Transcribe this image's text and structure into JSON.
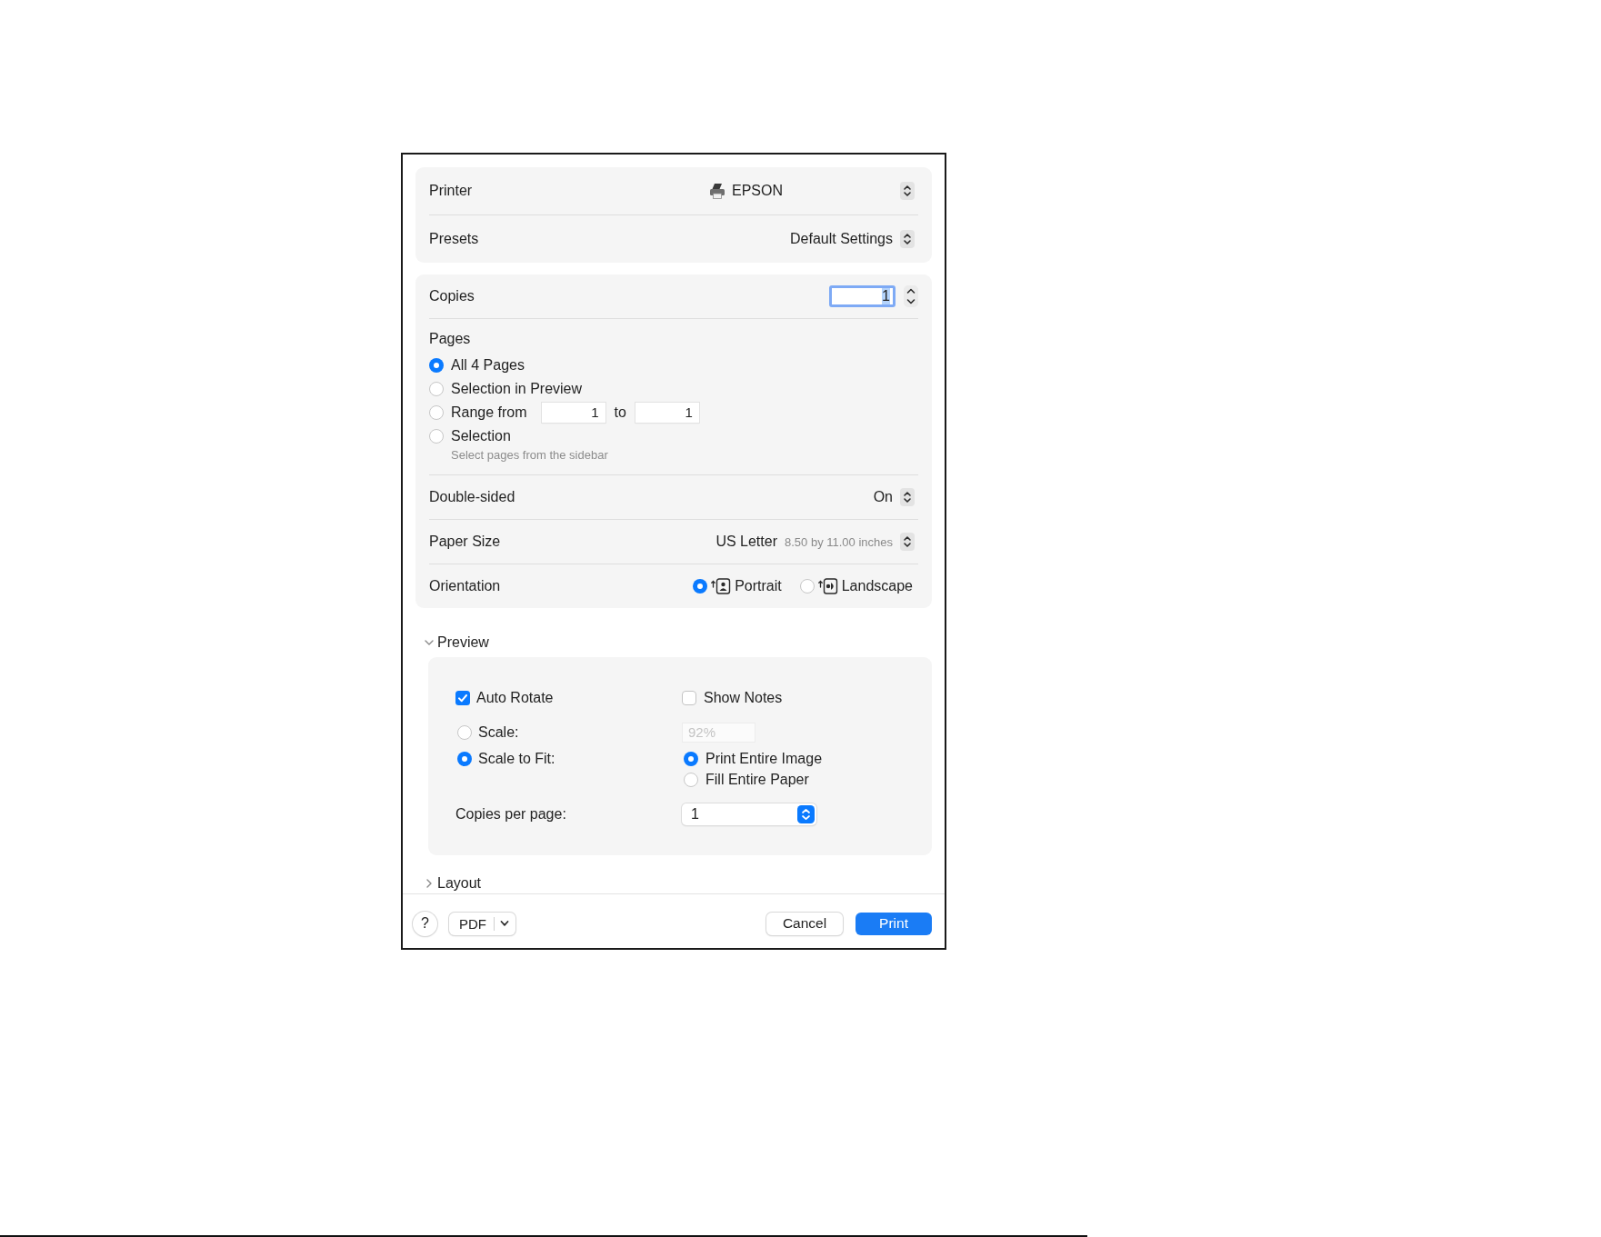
{
  "printer": {
    "label": "Printer",
    "value": "EPSON"
  },
  "presets": {
    "label": "Presets",
    "value": "Default Settings"
  },
  "copies": {
    "label": "Copies",
    "value": "1",
    "focused": true
  },
  "pages": {
    "label": "Pages",
    "options": [
      {
        "label": "All 4 Pages",
        "selected": true,
        "kind": "plain"
      },
      {
        "label": "Selection in Preview",
        "selected": false,
        "kind": "plain"
      },
      {
        "label": "Range from",
        "selected": false,
        "kind": "range",
        "from": "1",
        "to_label": "to",
        "to": "1"
      },
      {
        "label": "Selection",
        "selected": false,
        "kind": "hint",
        "hint": "Select pages from the sidebar"
      }
    ]
  },
  "double_sided": {
    "label": "Double-sided",
    "value": "On"
  },
  "paper_size": {
    "label": "Paper Size",
    "value": "US Letter",
    "detail": "8.50 by 11.00 inches"
  },
  "orientation": {
    "label": "Orientation",
    "options": [
      {
        "label": "Portrait",
        "selected": true,
        "kind": "portrait"
      },
      {
        "label": "Landscape",
        "selected": false,
        "kind": "landscape"
      }
    ]
  },
  "preview": {
    "title": "Preview",
    "expanded": true,
    "auto_rotate": {
      "label": "Auto Rotate",
      "checked": true
    },
    "show_notes": {
      "label": "Show Notes",
      "checked": false
    },
    "scale": {
      "label": "Scale:",
      "selected": false,
      "value": "92%",
      "disabled": true
    },
    "scale_to_fit": {
      "label": "Scale to Fit:",
      "selected": true,
      "options": [
        {
          "label": "Print Entire Image",
          "selected": true
        },
        {
          "label": "Fill Entire Paper",
          "selected": false
        }
      ]
    },
    "copies_per_page": {
      "label": "Copies per page:",
      "value": "1"
    }
  },
  "layout": {
    "title": "Layout",
    "expanded": false
  },
  "footer": {
    "help": "?",
    "pdf": "PDF",
    "buttons": [
      {
        "label": "Cancel",
        "kind": "secondary"
      },
      {
        "label": "Print",
        "kind": "default"
      }
    ]
  }
}
